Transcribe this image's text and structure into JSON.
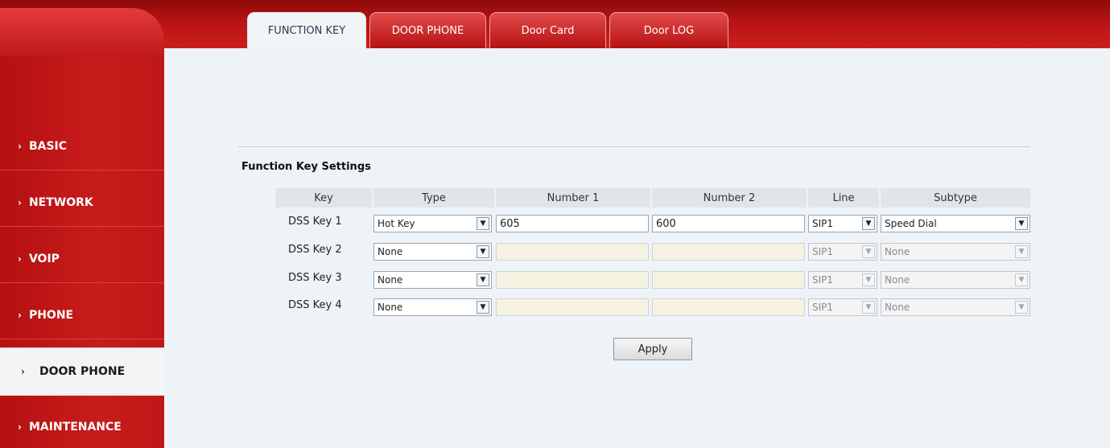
{
  "sidebar": {
    "items": [
      {
        "label": "BASIC"
      },
      {
        "label": "NETWORK"
      },
      {
        "label": "VOIP"
      },
      {
        "label": "PHONE"
      },
      {
        "label": "DOOR PHONE",
        "active": true
      },
      {
        "label": "MAINTENANCE"
      }
    ],
    "chevron": "›"
  },
  "tabs": [
    {
      "label": "FUNCTION KEY",
      "active": true
    },
    {
      "label": "DOOR PHONE"
    },
    {
      "label": "Door Card"
    },
    {
      "label": "Door LOG"
    }
  ],
  "section": {
    "title": "Function Key Settings"
  },
  "table": {
    "headers": [
      "Key",
      "Type",
      "Number 1",
      "Number 2",
      "Line",
      "Subtype"
    ],
    "rows": [
      {
        "key": "DSS Key 1",
        "type": "Hot Key",
        "number1": "605",
        "number2": "600",
        "line": "SIP1",
        "subtype": "Speed Dial",
        "enabled": true
      },
      {
        "key": "DSS Key 2",
        "type": "None",
        "number1": "",
        "number2": "",
        "line": "SIP1",
        "subtype": "None",
        "enabled": false
      },
      {
        "key": "DSS Key 3",
        "type": "None",
        "number1": "",
        "number2": "",
        "line": "SIP1",
        "subtype": "None",
        "enabled": false
      },
      {
        "key": "DSS Key 4",
        "type": "None",
        "number1": "",
        "number2": "",
        "line": "SIP1",
        "subtype": "None",
        "enabled": false
      }
    ]
  },
  "apply_label": "Apply",
  "icons": {
    "dropdown": "chevron-down-icon",
    "nav": "chevron-right-icon"
  },
  "colors": {
    "brand_red": "#c81c1c",
    "panel_bg": "#eef3f8",
    "disabled_input": "#f6f2e2"
  }
}
